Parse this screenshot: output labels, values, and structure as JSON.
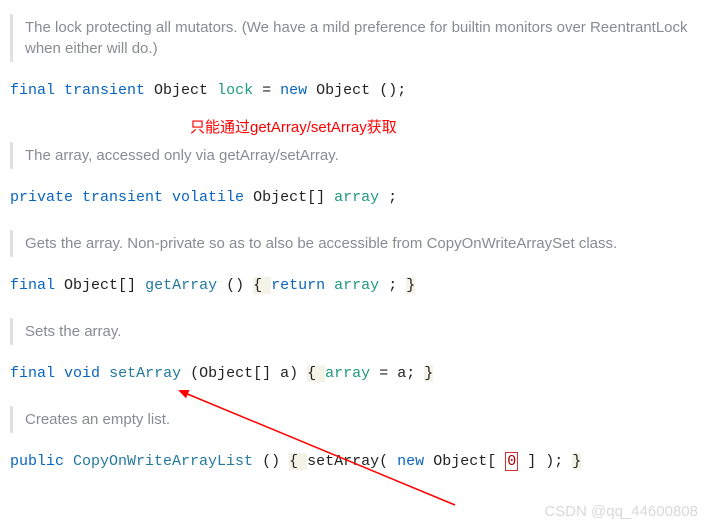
{
  "comments": {
    "lock": "The lock protecting all mutators. (We have a mild preference for builtin monitors over ReentrantLock when either will do.)",
    "array": "The array, accessed only via getArray/setArray.",
    "getArray": "Gets the array. Non-private so as to also be accessible from CopyOnWriteArraySet class.",
    "setArray": "Sets the array.",
    "ctor": "Creates an empty list."
  },
  "annotation": "只能通过getArray/setArray获取",
  "watermark": "CSDN @qq_44600808",
  "code": {
    "lock": {
      "mods": "final transient",
      "type": "Object",
      "name": "lock",
      "eq": " = ",
      "newKw": "new",
      "ctorType": "Object",
      "tail": "();"
    },
    "array": {
      "mods": "private transient volatile",
      "type": "Object[]",
      "name": "array",
      "tail": ";"
    },
    "getArray": {
      "mod": "final",
      "retType": "Object[]",
      "name": "getArray",
      "params": "()",
      "open": " { ",
      "ret": "return",
      "field": "array",
      "semi": "; ",
      "close": "}"
    },
    "setArray": {
      "mod1": "final",
      "mod2": "void",
      "name": "setArray",
      "params": "(Object[] a)",
      "open": " { ",
      "field": "array",
      "assign": " = a; ",
      "close": "}"
    },
    "ctor": {
      "mod": "public",
      "name": "CopyOnWriteArrayList",
      "params": "()",
      "open": " { ",
      "call": "setArray(",
      "newKw": "new",
      "arrType": " Object[",
      "zero": "0",
      "tail1": "]",
      "tail2": "); ",
      "close": "}"
    }
  }
}
